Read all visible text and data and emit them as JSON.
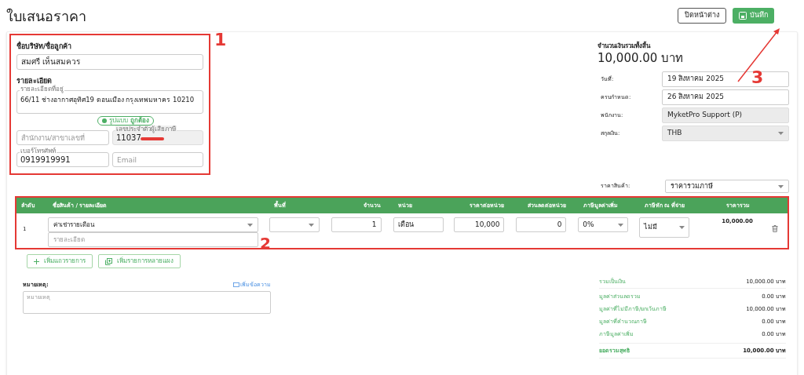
{
  "page_title": "ใบเสนอราคา",
  "header_buttons": [
    {
      "label": "ปิดหน้าต่าง",
      "kind": "outline"
    },
    {
      "label": "บันทึก",
      "kind": "primary"
    }
  ],
  "customer": {
    "name_label": "ชื่อบริษัท/ชื่อลูกค้า",
    "name_value": "สมศรี เห็นสมควร",
    "details_label": "รายละเอียด",
    "address": {
      "label": "รายละเอียดที่อยู่",
      "value": "66/11 ช่างอากาศอุทิศ19 ดอนเมือง กรุงเทพมหาคร 10210"
    },
    "format_badge": "รูปแบบ **ถูกต้อง**",
    "branch": {
      "placeholder": "สำนักงาน/สาขาเลขที่"
    },
    "tax_id": {
      "label": "เลขประจำตัวผู้เสียภาษี",
      "value": "11037",
      "redacted": true,
      "disabled": true
    },
    "phone": {
      "label": "เบอร์โทรศัพท์",
      "value": "0919919991"
    },
    "email": {
      "placeholder": "Email"
    }
  },
  "grand_total": {
    "label": "จำนวนเงินรวมทั้งสิ้น",
    "amount": "10,000.00 บาท"
  },
  "doc_fields": [
    {
      "label": "วันที่:",
      "value": "19 สิงหาคม 2025",
      "disabled": false,
      "kind": "text"
    },
    {
      "label": "ครบกำหนด:",
      "value": "26 สิงหาคม 2025",
      "disabled": false,
      "kind": "text"
    },
    {
      "label": "พนักงาน:",
      "value": "MyketPro Support (P)",
      "disabled": true,
      "kind": "text"
    },
    {
      "label": "สกุลเงิน:",
      "value": "THB",
      "disabled": true,
      "kind": "select"
    }
  ],
  "price_type": {
    "label": "ราคาสินค้า:",
    "value": "ราคารวมภาษี"
  },
  "table": {
    "columns": [
      "ลำดับ",
      "ชื่อสินค้า / รายละเอียด",
      "พื้นที่",
      "จำนวน",
      "หน่วย",
      "ราคาต่อหน่วย",
      "ส่วนลดต่อหน่วย",
      "ภาษีมูลค่าเพิ่ม",
      "ภาษีหัก ณ ที่จ่าย",
      "ราคารวม"
    ],
    "rows": [
      {
        "index": "1",
        "product": "ค่าเช่ารายเดือน",
        "description_placeholder": "รายละเอียด",
        "qty": "1",
        "unit": "เดือน",
        "unit_price": "10,000",
        "discount": "0",
        "vat": "0%",
        "wht": "ไม่มี",
        "total": "10,000.00"
      }
    ]
  },
  "add_buttons": [
    {
      "label": "เพิ่มแถวรายการ",
      "kind": "plus"
    },
    {
      "label": "เพิ่มรายการหลายแผง",
      "kind": "multi"
    }
  ],
  "notes": {
    "label": "หมายเหตุ:",
    "link": "เพิ่มข้อความ",
    "placeholder": "หมายเหตุ"
  },
  "totals": [
    {
      "label": "รวมเป็นเงิน",
      "value": "10,000.00 บาท",
      "kind": "normal"
    },
    {
      "label": "มูลค่าส่วนลดรวม",
      "value": "0.00 บาท",
      "kind": "normal"
    },
    {
      "label": "มูลค่าที่ไม่มีภาษี/ยกเว้นภาษี",
      "value": "10,000.00 บาท",
      "kind": "normal"
    },
    {
      "label": "มูลค่าที่คำนวณภาษี",
      "value": "0.00 บาท",
      "kind": "normal"
    },
    {
      "label": "ภาษีมูลค่าเพิ่ม",
      "value": "0.00 บาท",
      "kind": "normal"
    },
    {
      "label": "ยอดรวมสุทธิ",
      "value": "10,000.00 บาท",
      "kind": "grand"
    }
  ],
  "annotations": [
    {
      "label": "1"
    },
    {
      "label": "2"
    },
    {
      "label": "3"
    }
  ]
}
